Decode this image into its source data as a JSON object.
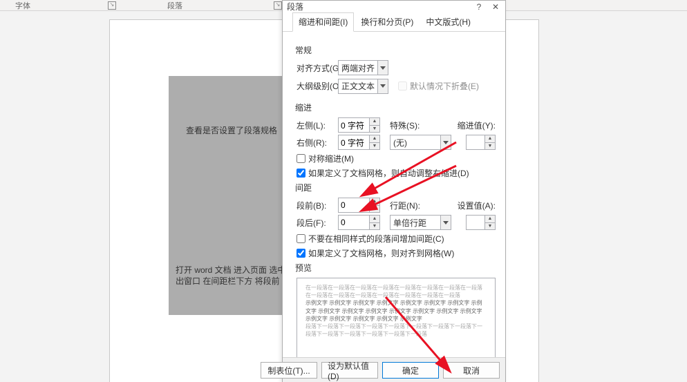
{
  "ribbon": {
    "group_font": "字体",
    "group_para": "段落"
  },
  "dialog": {
    "title": "段落",
    "tabs": {
      "indent": "缩进和间距(I)",
      "page": "换行和分页(P)",
      "asian": "中文版式(H)"
    },
    "sect_general": "常规",
    "alignment_label": "对齐方式(G):",
    "alignment_value": "两端对齐",
    "outline_label": "大纲级别(O):",
    "outline_value": "正文文本",
    "collapse_label": "默认情况下折叠(E)",
    "sect_indent": "缩进",
    "left_label": "左侧(L):",
    "left_value": "0 字符",
    "right_label": "右侧(R):",
    "right_value": "0 字符",
    "special_label": "特殊(S):",
    "special_value": "(无)",
    "indent_at_label": "缩进值(Y):",
    "indent_at_value": "",
    "sym_indent": "对称缩进(M)",
    "auto_adjust": "如果定义了文档网格，则自动调整右缩进(D)",
    "sect_spacing": "间距",
    "before_label": "段前(B):",
    "before_value": "0",
    "after_label": "段后(F):",
    "after_value": "0",
    "linespacing_label": "行距(N):",
    "linespacing_value": "单倍行距",
    "at_label": "设置值(A):",
    "at_value": "",
    "no_space_same": "不要在相同样式的段落间增加间距(C)",
    "snap_grid": "如果定义了文档网格，则对齐到网格(W)",
    "sect_preview": "预览",
    "preview_text_gray": "在一段落在一段落在一段落在一段落在一段落在一段落在一段落在一段落在一段落在一段落在一段落在一段落在一段落在一段落在一段落",
    "preview_text_bold": "示例文字 示例文字 示例文字 示例文字 示例文字 示例文字 示例文字 示例文字 示例文字 示例文字 示例文字 示例文字 示例文字 示例文字 示例文字 示例文字 示例文字 示例文字 示例文字 示例文字",
    "preview_text_gray2": "段落下一段落下一段落下一段落下一段落下一段落下一段落下一段落下一段落下一段落下一段落下一段落下一段落下一段落",
    "btn_tabs": "制表位(T)...",
    "btn_default": "设为默认值(D)",
    "btn_ok": "确定",
    "btn_cancel": "取消"
  },
  "doc": {
    "line_check": "查看是否设置了段落规格",
    "line_open": "打开 word 文档   进入页面   选中",
    "line_out": "出窗口   在间距栏下方   将段前"
  }
}
